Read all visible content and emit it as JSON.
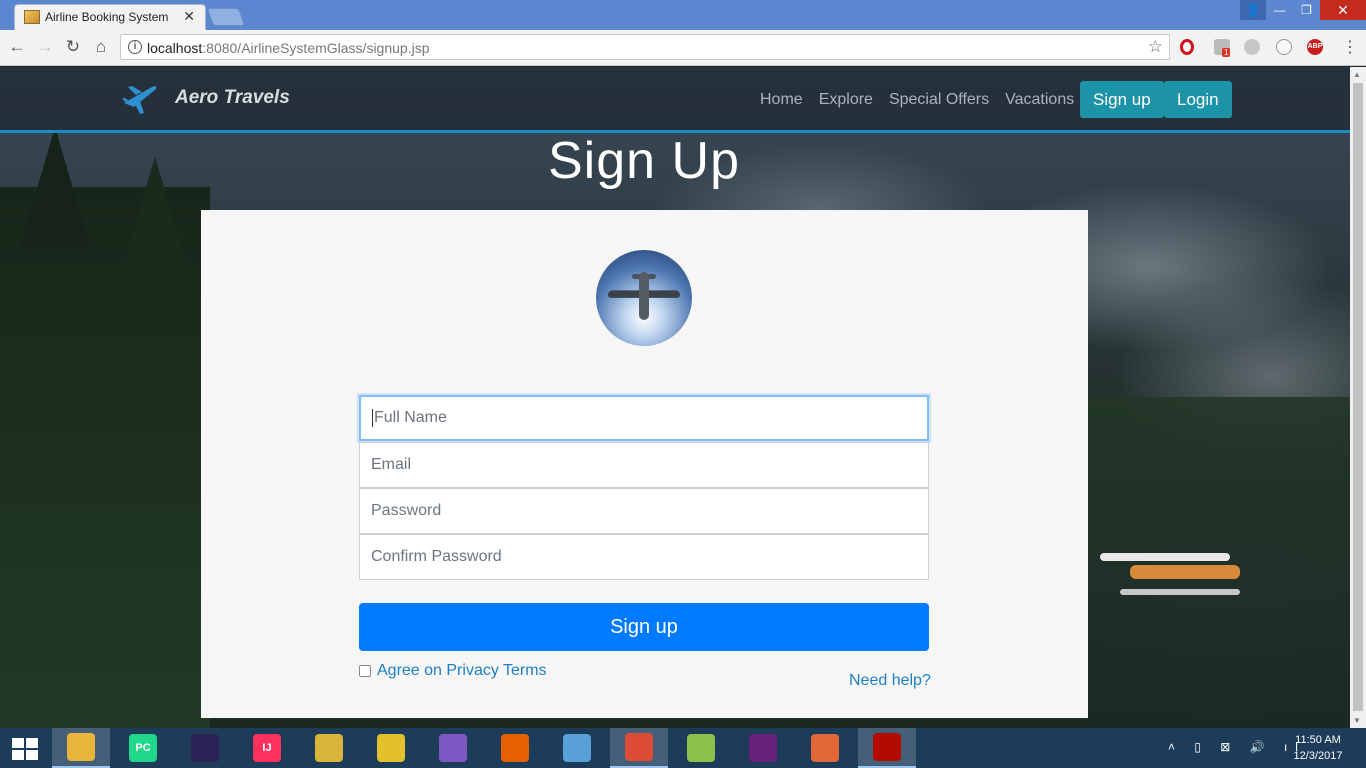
{
  "browser": {
    "tab_title": "Airline Booking System",
    "url_host": "localhost",
    "url_rest": ":8080/AirlineSystemGlass/signup.jsp",
    "ext_badge": "1",
    "ext_abp": "ABP"
  },
  "nav": {
    "brand": "Aero Travels",
    "links": [
      "Home",
      "Explore",
      "Special Offers",
      "Vacations"
    ],
    "signup_label": "Sign up",
    "login_label": "Login"
  },
  "page": {
    "heading": "Sign Up"
  },
  "form": {
    "full_name_placeholder": "Full Name",
    "email_placeholder": "Email",
    "password_placeholder": "Password",
    "confirm_password_placeholder": "Confirm Password",
    "submit_label": "Sign up",
    "agree_label": "Agree on Privacy Terms",
    "agree_checked": false,
    "help_label": "Need help?"
  },
  "taskbar": {
    "apps": [
      {
        "name": "file-explorer-icon",
        "label": "",
        "color": "#e8b53a"
      },
      {
        "name": "pycharm-icon",
        "label": "PC",
        "color": "#21d789"
      },
      {
        "name": "eclipse-icon",
        "label": "",
        "color": "#2c2255"
      },
      {
        "name": "intellij-icon",
        "label": "IJ",
        "color": "#fe315d"
      },
      {
        "name": "tools-icon",
        "label": "",
        "color": "#d9b43a"
      },
      {
        "name": "puzzle-icon",
        "label": "",
        "color": "#e2c12c"
      },
      {
        "name": "tor-icon",
        "label": "",
        "color": "#7e57c2"
      },
      {
        "name": "firefox-icon",
        "label": "",
        "color": "#e66000"
      },
      {
        "name": "virtualbox-icon",
        "label": "",
        "color": "#5aa0d8"
      },
      {
        "name": "chrome-icon",
        "label": "",
        "color": "#dd4b39"
      },
      {
        "name": "notepad-plus-icon",
        "label": "",
        "color": "#8bc34a"
      },
      {
        "name": "visual-studio-icon",
        "label": "",
        "color": "#68217a"
      },
      {
        "name": "matlab-icon",
        "label": "",
        "color": "#e16737"
      },
      {
        "name": "acrobat-icon",
        "label": "",
        "color": "#b30b00"
      }
    ],
    "time": "11:50 AM",
    "date": "12/3/2017"
  }
}
